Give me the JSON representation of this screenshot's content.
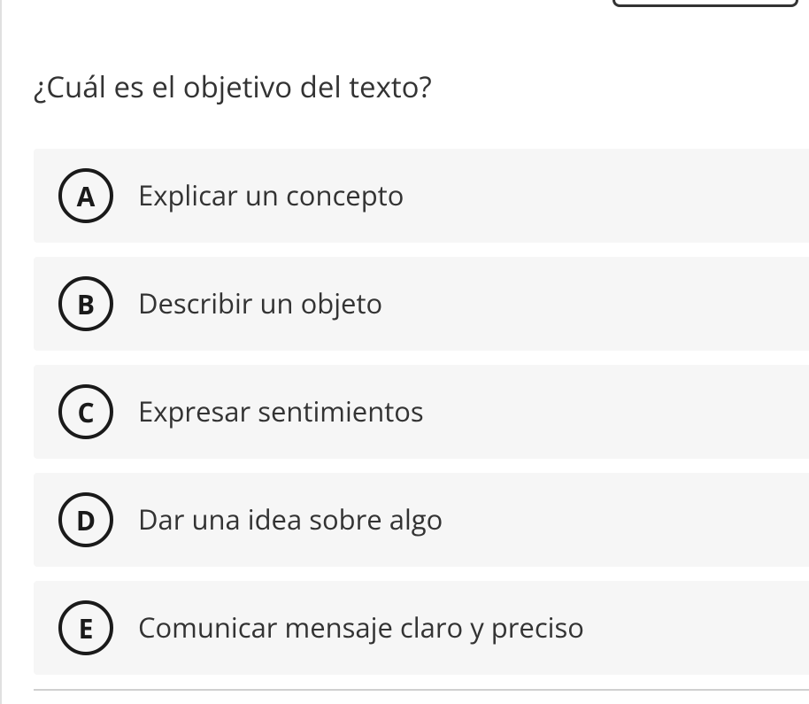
{
  "question": "¿Cuál es el objetivo del texto?",
  "options": [
    {
      "letter": "A",
      "text": "Explicar un concepto"
    },
    {
      "letter": "B",
      "text": "Describir un objeto"
    },
    {
      "letter": "C",
      "text": "Expresar sentimientos"
    },
    {
      "letter": "D",
      "text": "Dar una idea sobre algo"
    },
    {
      "letter": "E",
      "text": "Comunicar mensaje claro y preciso"
    }
  ]
}
